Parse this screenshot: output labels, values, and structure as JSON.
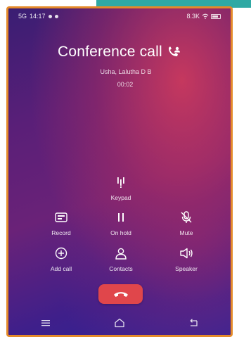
{
  "status_bar": {
    "time": "14:17",
    "carrier": "5G",
    "right_text": "8.3K"
  },
  "call": {
    "title": "Conference call",
    "participants": "Usha, Lalutha D B",
    "duration": "00:02"
  },
  "controls": {
    "keypad": "Keypad",
    "record": "Record",
    "hold": "On hold",
    "mute": "Mute",
    "add_call": "Add call",
    "contacts": "Contacts",
    "speaker": "Speaker"
  },
  "icons": {
    "conference": "conference-call-icon",
    "keypad": "keypad-icon",
    "record": "record-icon",
    "hold": "pause-icon",
    "mute": "mute-mic-icon",
    "add_call": "add-call-icon",
    "contacts": "contacts-icon",
    "speaker": "speaker-icon",
    "end_call": "end-call-icon",
    "nav_menu": "menu-icon",
    "nav_home": "home-icon",
    "nav_back": "back-icon"
  },
  "colors": {
    "frame_border": "#e48a2a",
    "top_accent": "#2fa9a4",
    "end_call": "#e0464b"
  }
}
